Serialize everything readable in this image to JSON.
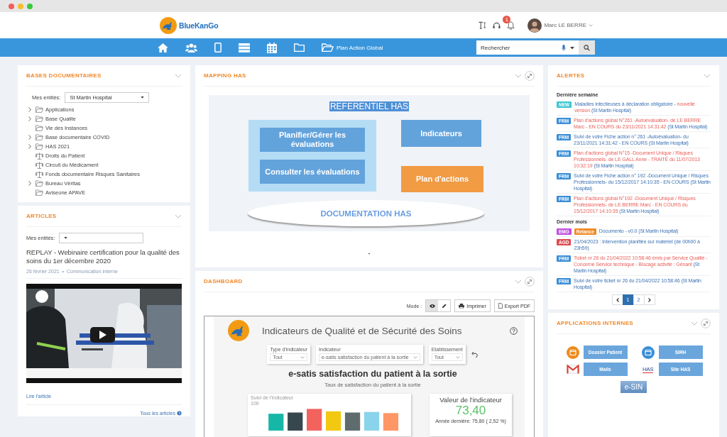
{
  "header": {
    "logo_text": "BlueKanGo",
    "notification_count": "1",
    "user_name": "Marc LE BERRE"
  },
  "nav": {
    "items": [
      {
        "kind": "home"
      },
      {
        "kind": "users"
      },
      {
        "kind": "tablet"
      },
      {
        "kind": "server"
      },
      {
        "kind": "calendar"
      },
      {
        "kind": "folder"
      },
      {
        "kind": "folder-open",
        "label": "Plan Action Global"
      }
    ],
    "search": {
      "placeholder": "Rechercher"
    }
  },
  "bases_documentaires": {
    "title": "BASES DOCUMENTAIRES",
    "entity_label": "Mes entités:",
    "entity_value": "St Martin Hospital",
    "tree": [
      {
        "label": "Applications",
        "kind": "folder",
        "collapsible": true
      },
      {
        "label": "Base Qualite",
        "kind": "folder",
        "collapsible": true
      },
      {
        "label": "Vie des Instances",
        "kind": "folder",
        "collapsible": false
      },
      {
        "label": "Base documentaire COVID",
        "kind": "folder",
        "collapsible": true
      },
      {
        "label": "HAS 2021",
        "kind": "folder",
        "collapsible": true
      },
      {
        "label": "Droits du Patient",
        "kind": "scale",
        "collapsible": false
      },
      {
        "label": "Circuit du Médicament",
        "kind": "scale",
        "collapsible": false
      },
      {
        "label": "Fonds documentaire Risques Sanitaires",
        "kind": "scale",
        "collapsible": false
      },
      {
        "label": "Bureau Véritas",
        "kind": "folder",
        "collapsible": true
      },
      {
        "label": "Aviseone APAVE",
        "kind": "folder",
        "collapsible": false
      }
    ]
  },
  "articles": {
    "title": "ARTICLES",
    "entity_label": "Mes entités:",
    "article": {
      "title": "REPLAY - Webinaire certification pour la qualité des soins du 1er décembre 2020",
      "date": "26 février 2021",
      "separator": "•",
      "category": "Communication interne",
      "link": "Lire l'article"
    },
    "all_link": "Tous les articles"
  },
  "mapping": {
    "title": "MAPPING HAS",
    "heading": "REFERENTIEL HAS",
    "evaluation_boxes": [
      "Planifier/Gérer les évaluations",
      "Consulter les évaluations"
    ],
    "indicators": "Indicateurs",
    "action_plan": "Plan d'actions",
    "documentation": "DOCUMENTATION HAS",
    "footer": "-"
  },
  "dashboard": {
    "title": "DASHBOARD",
    "mode_label": "Mode :",
    "modes": [
      {
        "kind": "view",
        "selected": true
      },
      {
        "kind": "edit",
        "selected": false
      }
    ],
    "buttons": [
      {
        "kind": "print",
        "label": "Imprimer"
      },
      {
        "kind": "pdf",
        "label": "Export PDF"
      }
    ],
    "report": {
      "title": "Indicateurs de Qualité et de Sécurité des Soins",
      "filters": [
        {
          "label": "Type d'indicateur",
          "value": "Tout"
        },
        {
          "label": "Indicateur",
          "value": "e-satis satisfaction du patient à la sortie"
        },
        {
          "label": "Etablissement",
          "value": "Tout"
        }
      ],
      "heading": "e-satis satisfaction du patient à la sortie",
      "subheading": "Taux de satisfaction du patient à la sortie",
      "chart_title": "Suivi de l'indicateur",
      "chart_tick": "100",
      "kpi_title": "Valeur de l'indicateur",
      "kpi_value": "73,40",
      "kpi_note": "Année dernière: 75,80 ( 2,52 %)"
    }
  },
  "alertes": {
    "title": "ALERTES",
    "groups": [
      {
        "label": "Dernière semaine",
        "items": [
          {
            "tags": [
              {
                "label": "NEW",
                "color": "#3ec6d3"
              }
            ],
            "text": "Maladies infectieuses à déclaration obligatoire - ",
            "highlight": "nouvelle version",
            "entity": "(St Martin Hospital)",
            "urgent": false
          },
          {
            "tags": [
              {
                "label": "FRM",
                "color": "#3a8fd8"
              }
            ],
            "text": "Plan d'actions global N°261 -Autoévaluation- de LE BERRE Marc - EN COURS du 23/11/2021 14:31:42",
            "entity": "(St Martin Hospital)",
            "urgent": true
          },
          {
            "tags": [
              {
                "label": "FRM",
                "color": "#3a8fd8"
              }
            ],
            "text": "Suivi de votre Fiche action n° 261 -Autoévaluation- du 23/11/2021 14:31:42 - EN COURS",
            "entity": "(St Martin Hospital)",
            "urgent": false
          },
          {
            "tags": [
              {
                "label": "FRM",
                "color": "#3a8fd8"
              }
            ],
            "text": "Plan d'actions global N°15 -Document Unique / Risques Professionnels- de LE GALL Anne - TRAITÉ du 11/07/2013 10:32:19",
            "entity": "(St Martin Hospital)",
            "urgent": true
          },
          {
            "tags": [
              {
                "label": "FRM",
                "color": "#3a8fd8"
              }
            ],
            "text": "Suivi de votre Fiche action n° 192 -Document Unique / Risques Professionnels- du 15/12/2017 14:10:35 - EN COURS",
            "entity": "(St Martin Hospital)",
            "urgent": false
          },
          {
            "tags": [
              {
                "label": "FRM",
                "color": "#3a8fd8"
              }
            ],
            "text": "Plan d'actions global N°192 -Document Unique / Risques Professionnels- de LE BERRE Marc - EN COURS du 15/12/2017 14:10:35",
            "entity": "(St Martin Hospital)",
            "urgent": true
          }
        ]
      },
      {
        "label": "Dernier mois",
        "items": [
          {
            "tags": [
              {
                "label": "EMG",
                "color": "#c04fe0"
              },
              {
                "label": "Relance",
                "color": "#f08a24"
              }
            ],
            "text": "Documento - v0.0",
            "entity": "(St Martin Hospital)",
            "urgent": false
          },
          {
            "tags": [
              {
                "label": "AGD",
                "color": "#e04a50"
              }
            ],
            "text": "21/04/2023 : Intervention planifiée sur matériel (de 00h00 à 23h59)",
            "urgent": false
          },
          {
            "tags": [
              {
                "label": "FRM",
                "color": "#3a8fd8"
              }
            ],
            "text": "Ticket nr 26 du 21/04/2022 10:58:46 émis par Service Qualité - Concerne Service technique - Blocage activité : Gênant",
            "entity": "(St Martin Hospital)",
            "urgent": true
          },
          {
            "tags": [
              {
                "label": "FRM",
                "color": "#3a8fd8"
              }
            ],
            "text": "Suivi de votre ticket nr 26 du 21/04/2022 10:58:46",
            "entity": "(St Martin Hospital)",
            "urgent": false
          }
        ]
      }
    ],
    "pages": [
      {
        "label": "1",
        "selected": true
      },
      {
        "label": "2",
        "selected": false
      }
    ]
  },
  "applications": {
    "title": "APPLICATIONS INTERNES",
    "apps": [
      {
        "label": "Dossier Patient"
      },
      {
        "label": "SIRH"
      },
      {
        "label": "Mails"
      },
      {
        "label": "Site HAS",
        "logo_text": "HAS"
      }
    ],
    "logo_text": "e-SIN"
  }
}
